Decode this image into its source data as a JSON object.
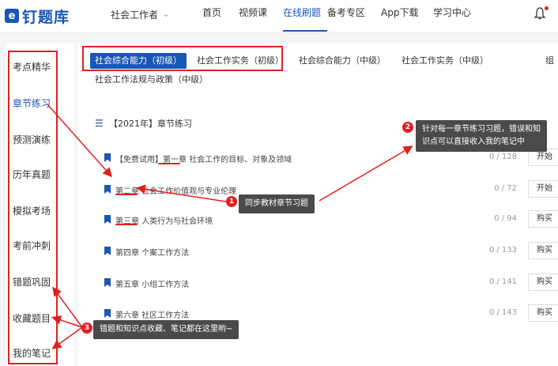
{
  "header": {
    "logo_text": "钉题库",
    "logo_mark": "e",
    "role_select": "社会工作者",
    "nav": [
      "首页",
      "视频课",
      "在线刷题",
      "备考专区",
      "App下载",
      "学习中心"
    ],
    "active_nav": "在线刷题"
  },
  "sidebar": {
    "items": [
      "考点精华",
      "章节练习",
      "预测演练",
      "历年真题",
      "模拟考场",
      "考前冲刺",
      "错题巩固",
      "收藏题目",
      "我的笔记"
    ],
    "active": "章节练习"
  },
  "tabs": [
    "社会综合能力（初级）",
    "社会工作实务（初级）",
    "社会综合能力（中级）",
    "社会工作实务（中级）",
    "社会工作法规与政策（中级）"
  ],
  "tab_overflow": "组",
  "section_title": "【2021年】章节练习",
  "chapters": [
    {
      "title": "【免费试用】第一章 社会工作的目标、对象及领域",
      "progress": "0 / 128",
      "button": "开始"
    },
    {
      "title": "第二章 社会工作价值观与专业伦理",
      "progress": "0 / 72",
      "button": "开始"
    },
    {
      "title": "第三章 人类行为与社会环境",
      "progress": "0 / 94",
      "button": "购买"
    },
    {
      "title": "第四章 个案工作方法",
      "progress": "0 / 133",
      "button": "购买"
    },
    {
      "title": "第五章 小组工作方法",
      "progress": "0 / 141",
      "button": "购买"
    },
    {
      "title": "第六章 社区工作方法",
      "progress": "0 / 143",
      "button": "购买"
    }
  ],
  "callouts": [
    {
      "badge": "1",
      "text": "同步教材章节习题"
    },
    {
      "badge": "2",
      "lines": [
        "针对每一章节练习习题，错误和知",
        "识点可以直接收入我的笔记中"
      ]
    },
    {
      "badge": "3",
      "text": "错题和知识点收藏、笔记都在这里哟~"
    }
  ],
  "colors": {
    "brand": "#1a56b5",
    "annotation": "#e02020",
    "callout_bg": "#4a4a4a"
  },
  "icons": {
    "bookmark": "bookmark-icon",
    "list": "list-icon",
    "bell": "bell-icon",
    "chevron": "chevron-down-icon"
  }
}
